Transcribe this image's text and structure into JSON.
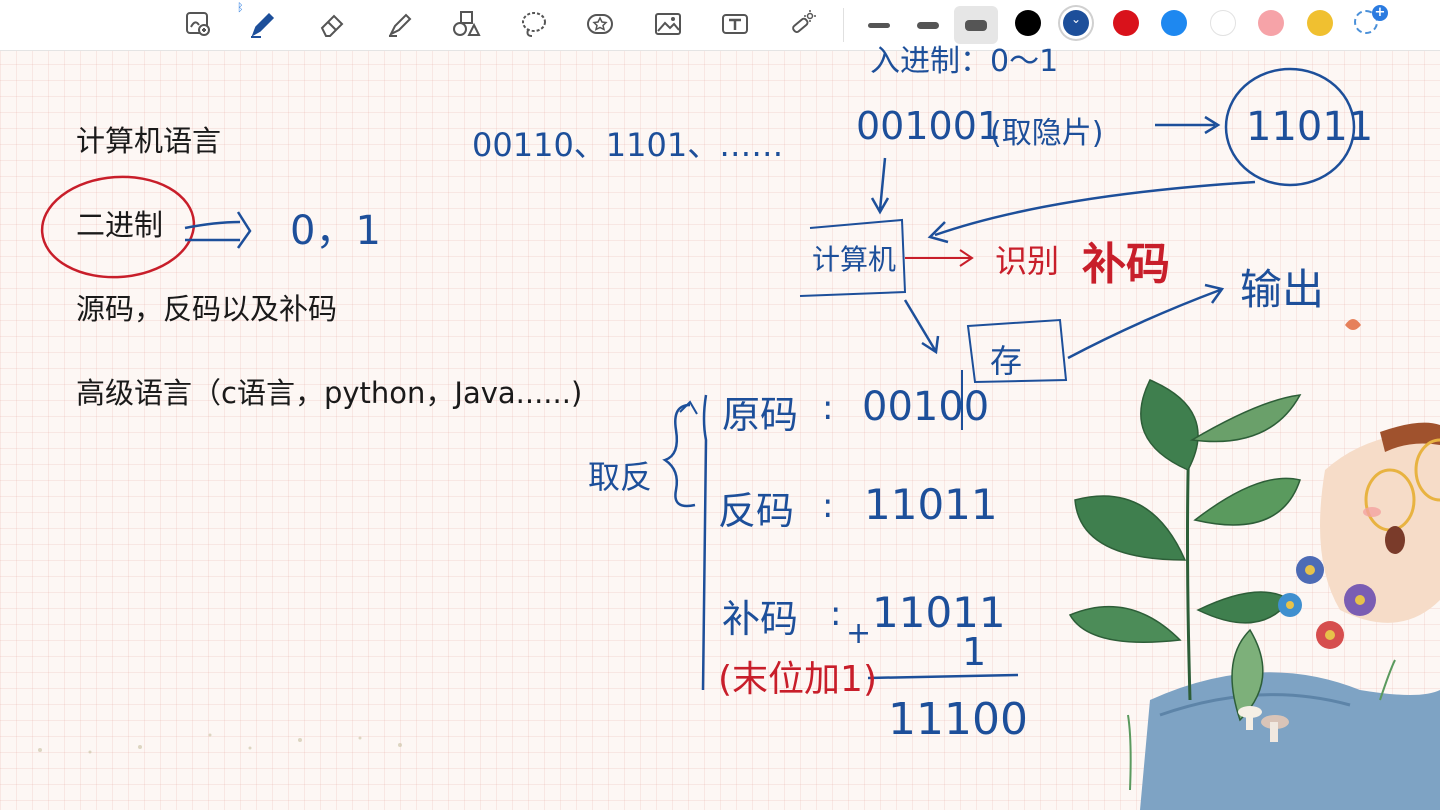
{
  "toolbar": {
    "tools": [
      {
        "id": "lasso-zoom",
        "icon": "zoom-writing-icon"
      },
      {
        "id": "pen",
        "icon": "pen-icon"
      },
      {
        "id": "eraser",
        "icon": "eraser-icon"
      },
      {
        "id": "highlighter",
        "icon": "highlighter-icon"
      },
      {
        "id": "shapes",
        "icon": "shapes-icon"
      },
      {
        "id": "lasso",
        "icon": "lasso-icon"
      },
      {
        "id": "sticker",
        "icon": "sticker-icon"
      },
      {
        "id": "image",
        "icon": "image-icon"
      },
      {
        "id": "text",
        "icon": "text-icon"
      },
      {
        "id": "laser",
        "icon": "laser-pointer-icon"
      }
    ],
    "bluetooth_icon": "bluetooth-icon",
    "stroke_sizes": [
      "thin",
      "medium",
      "thick"
    ],
    "selected_stroke": "thick",
    "colors": [
      "#000000",
      "#1d4f9a",
      "#d9121b",
      "#1e88f0",
      "#ffffff",
      "#f6a3a8",
      "#f0c030"
    ],
    "selected_color": "#1d4f9a"
  },
  "notes": {
    "line1": "计算机语言",
    "line2": "二进制",
    "line3": "源码，反码以及补码",
    "line4": "高级语言（c语言，python，Java......)"
  },
  "handwriting": {
    "zero_one": "0，1",
    "binary_examples": "00110、1101、……",
    "top_partial": "入进制：0～1",
    "chip_code": "001001",
    "chip_note": "(取隐片)",
    "circled_code": "11011",
    "computer": "计算机",
    "recognize": "识别",
    "complement_red": "补码",
    "storage": "存",
    "output": "输出",
    "invert": "取反",
    "original_label": "原码",
    "original_value": "00100",
    "inverse_label": "反码",
    "inverse_value": "11011",
    "complement_label": "补码",
    "complement_value": "11011",
    "plus_sign": "+",
    "add_one": "1",
    "last_bit_add": "(末位加1)",
    "result": "11100"
  }
}
